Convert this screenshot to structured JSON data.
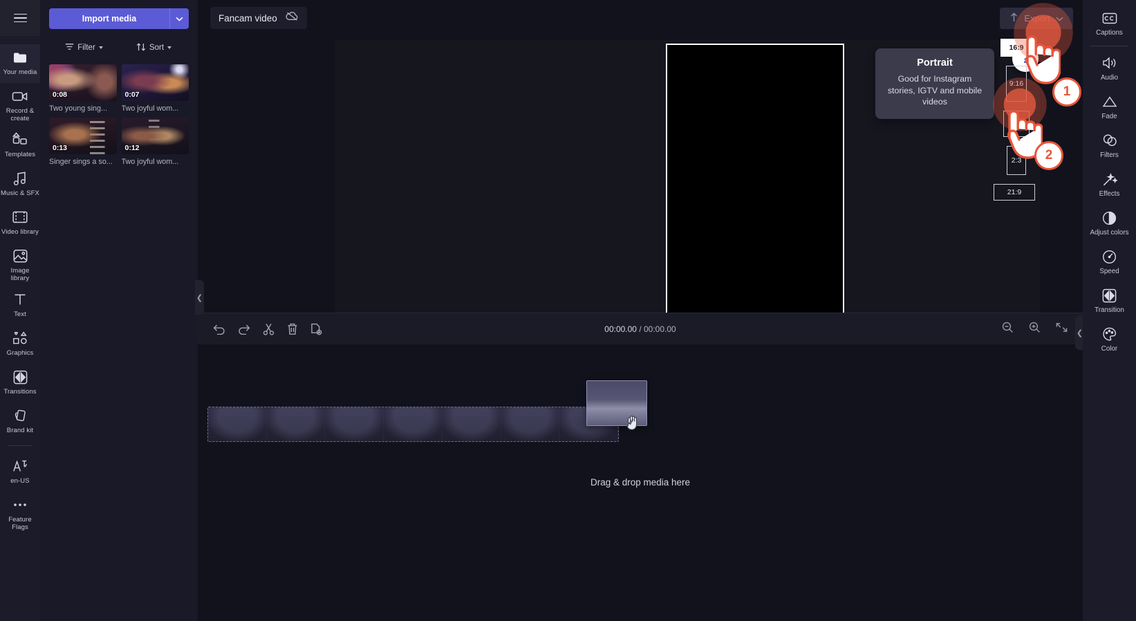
{
  "app": {
    "project_title": "Fancam video",
    "cloud_status_icon": "cloud-off-icon",
    "menu_icon": "hamburger-menu-icon"
  },
  "media_panel": {
    "import_label": "Import media",
    "import_caret_icon": "chevron-down-icon",
    "filter_label": "Filter",
    "sort_label": "Sort",
    "filter_icon": "filter-icon",
    "sort_icon": "sort-arrows-icon",
    "items": [
      {
        "duration": "0:08",
        "name": "Two young sing..."
      },
      {
        "duration": "0:07",
        "name": "Two joyful wom..."
      },
      {
        "duration": "0:13",
        "name": "Singer sings a so..."
      },
      {
        "duration": "0:12",
        "name": "Two joyful wom..."
      }
    ],
    "collapse_icon": "chevron-left-icon"
  },
  "left_rail": {
    "items": [
      {
        "label": "Your media",
        "icon": "folder-icon",
        "active": true
      },
      {
        "label": "Record & create",
        "icon": "video-camera-icon",
        "active": false
      },
      {
        "label": "Templates",
        "icon": "templates-icon",
        "active": false
      },
      {
        "label": "Music & SFX",
        "icon": "music-note-icon",
        "active": false
      },
      {
        "label": "Video library",
        "icon": "film-strip-icon",
        "active": false
      },
      {
        "label": "Image library",
        "icon": "image-icon",
        "active": false
      },
      {
        "label": "Text",
        "icon": "text-t-icon",
        "active": false
      },
      {
        "label": "Graphics",
        "icon": "shapes-icon",
        "active": false
      },
      {
        "label": "Transitions",
        "icon": "transition-icon",
        "active": false
      },
      {
        "label": "Brand kit",
        "icon": "brand-kit-icon",
        "active": false
      }
    ],
    "bottom_items": [
      {
        "label": "en-US",
        "icon": "language-icon"
      },
      {
        "label": "Feature Flags",
        "icon": "ellipsis-icon"
      }
    ]
  },
  "topbar": {
    "export_label": "Export",
    "export_icon": "upload-arrow-icon",
    "export_caret_icon": "chevron-down-icon"
  },
  "preview": {
    "transport": [
      {
        "name": "skip-to-start-button",
        "icon": "skip-back-icon"
      },
      {
        "name": "rewind-5s-button",
        "icon": "rewind-5-icon"
      },
      {
        "name": "play-button",
        "icon": "play-icon"
      },
      {
        "name": "forward-5s-button",
        "icon": "forward-5-icon"
      },
      {
        "name": "skip-to-end-button",
        "icon": "skip-forward-icon"
      }
    ],
    "fullscreen_icon": "fullscreen-icon",
    "collapse_icon": "chevron-left-icon",
    "help_label": "?"
  },
  "timeline": {
    "tools": [
      {
        "name": "undo-button",
        "icon": "undo-icon"
      },
      {
        "name": "redo-button",
        "icon": "redo-icon"
      },
      {
        "name": "split-button",
        "icon": "scissors-icon"
      },
      {
        "name": "delete-button",
        "icon": "trash-icon"
      },
      {
        "name": "duplicate-button",
        "icon": "duplicate-icon"
      }
    ],
    "current_time": "00:00.00",
    "separator": " / ",
    "total_time": "00:00.00",
    "zoom_out_icon": "zoom-out-icon",
    "zoom_in_icon": "zoom-in-icon",
    "fit_icon": "fit-to-timeline-icon",
    "drop_hint": "Drag & drop media here"
  },
  "right_panel": {
    "items": [
      {
        "label": "Captions",
        "icon": "closed-captions-icon"
      },
      {
        "label": "Audio",
        "icon": "speaker-icon"
      },
      {
        "label": "Fade",
        "icon": "fade-icon"
      },
      {
        "label": "Filters",
        "icon": "filters-circles-icon"
      },
      {
        "label": "Effects",
        "icon": "magic-wand-icon"
      },
      {
        "label": "Adjust colors",
        "icon": "contrast-half-circle-icon"
      },
      {
        "label": "Speed",
        "icon": "speedometer-icon"
      },
      {
        "label": "Transition",
        "icon": "transition-icon"
      },
      {
        "label": "Color",
        "icon": "palette-icon"
      }
    ]
  },
  "aspect_ratio": {
    "options": [
      {
        "label": "16:9",
        "selected": true
      },
      {
        "label": "9:16",
        "selected": false
      },
      {
        "label": "1:1",
        "selected": false
      },
      {
        "label": "2:3",
        "selected": false
      },
      {
        "label": "21:9",
        "selected": false
      }
    ]
  },
  "tooltip": {
    "title": "Portrait",
    "body": "Good for Instagram stories, IGTV and mobile videos"
  },
  "annotations": {
    "step1": "1",
    "step2": "2",
    "accent_color": "#e8563a"
  },
  "colors": {
    "accent": "#5b5bd6",
    "rail_bg": "#1b1b2a",
    "panel_bg": "#191927",
    "stage_bg": "#12121c"
  }
}
